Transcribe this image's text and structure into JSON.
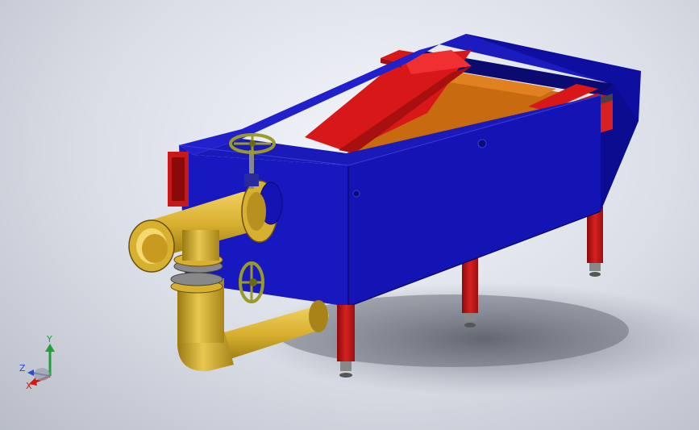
{
  "viewport": {
    "background_top": "#f4f6fa",
    "background_bottom": "#b8bdc8"
  },
  "model": {
    "body_color": "#1414b4",
    "body_dark": "#0a0a8c",
    "body_side": "#1a1ac8",
    "ramp_color": "#d81818",
    "bed_color": "#c86a10",
    "pipe_color": "#d8b030",
    "pipe_dark": "#a88418",
    "leg_color": "#c81818",
    "handwheel_color": "#9a9a28"
  },
  "triad": {
    "y_label": "Y",
    "z_label": "Z",
    "x_label": "X",
    "y_color": "#1fa03a",
    "x_color": "#d01818",
    "z_color": "#2a4ad8"
  }
}
